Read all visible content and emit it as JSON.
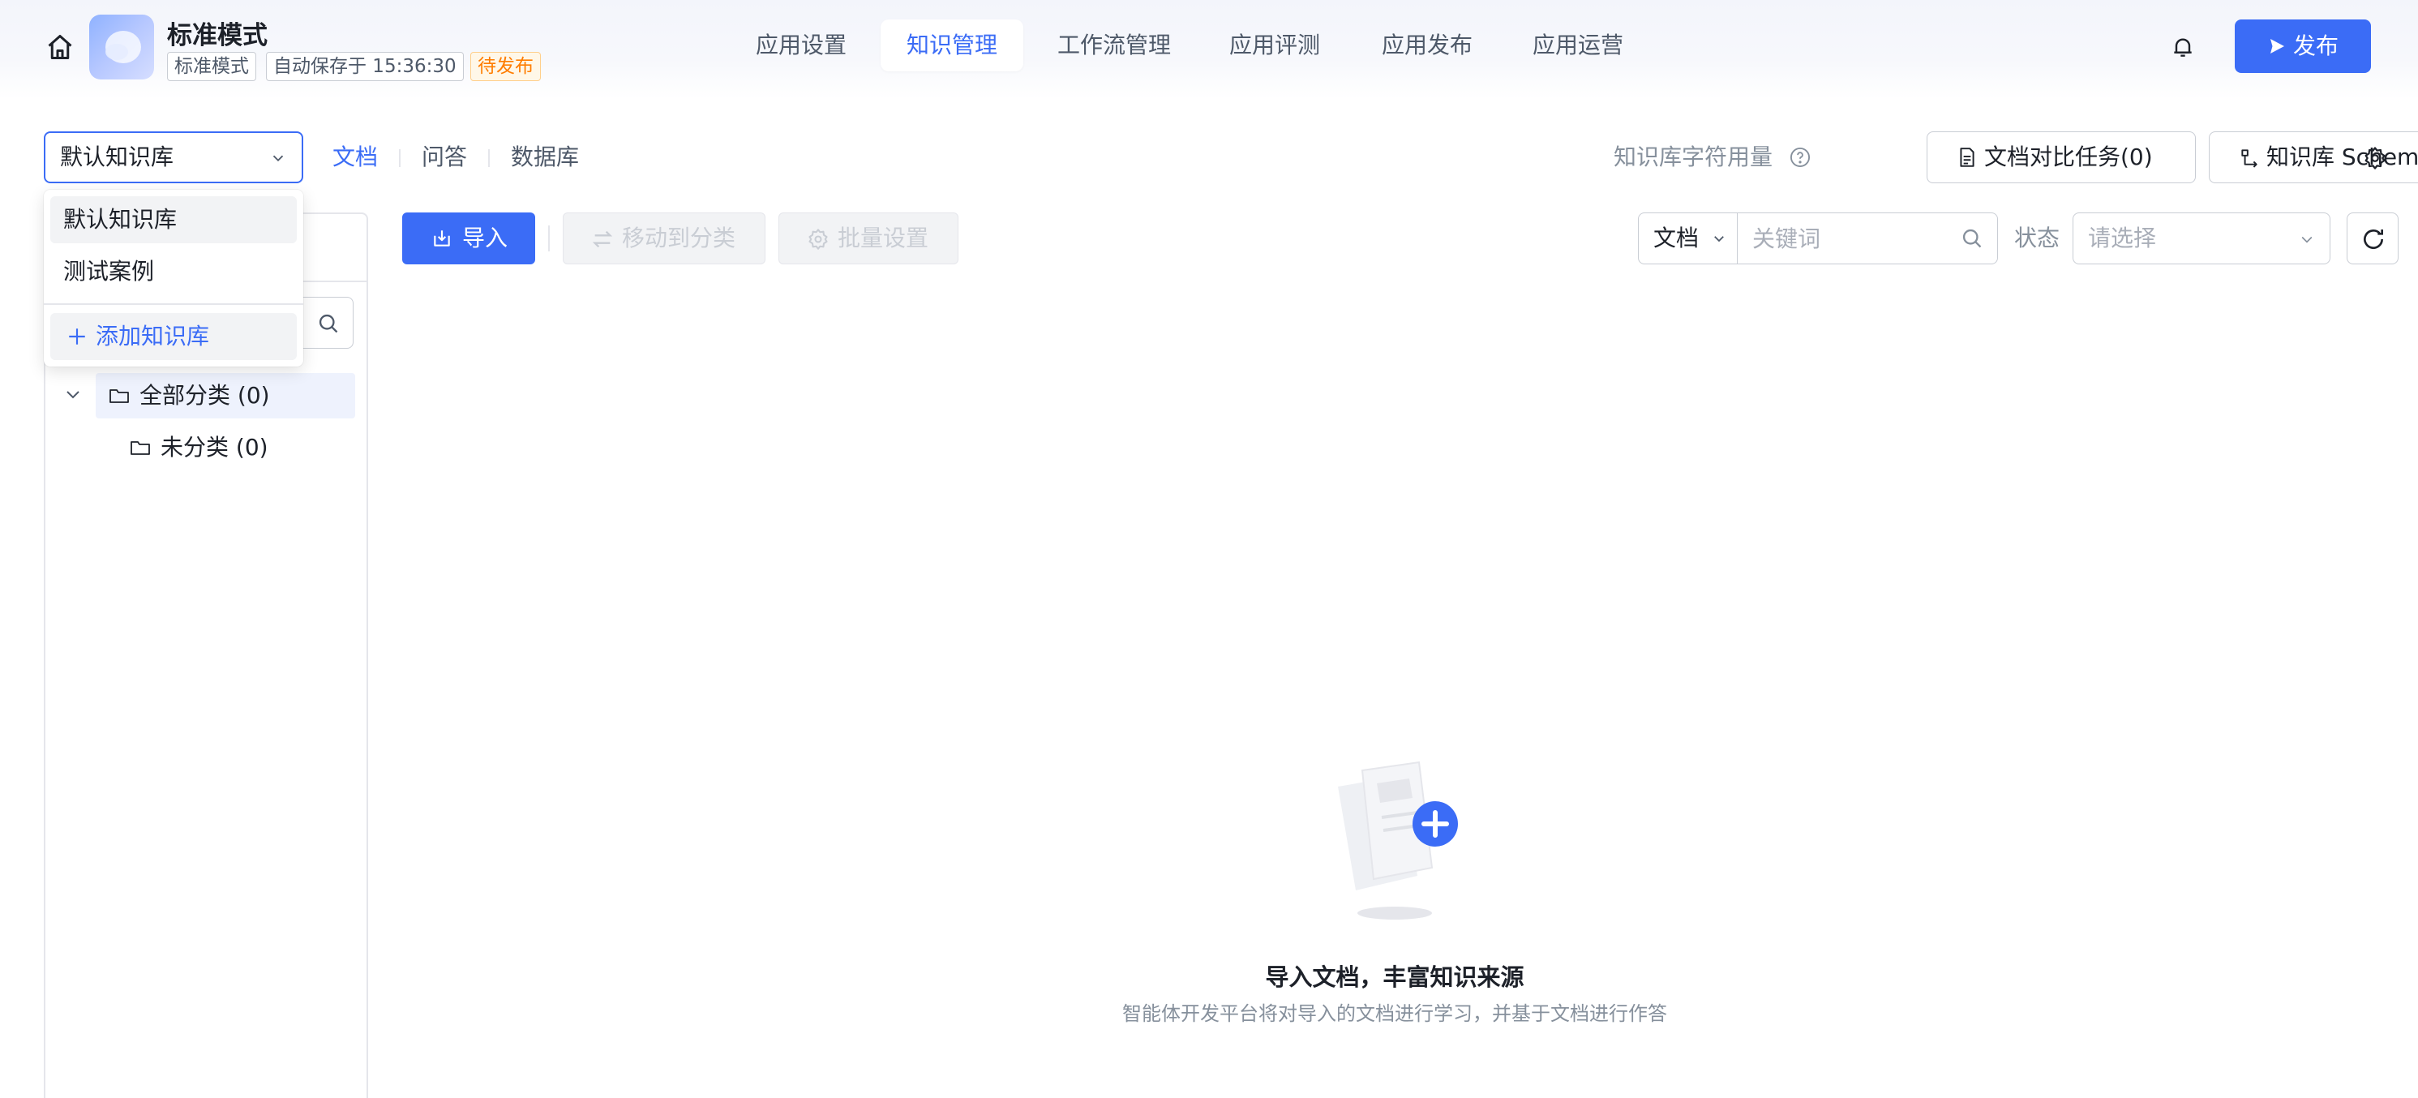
{
  "app": {
    "title": "标准模式",
    "tags": [
      "标准模式",
      "自动保存于 15:36:30",
      "待发布"
    ],
    "publish_label": "发布"
  },
  "nav": {
    "items": [
      "应用设置",
      "知识管理",
      "工作流管理",
      "应用评测",
      "应用发布",
      "应用运营"
    ],
    "active": "知识管理"
  },
  "knowledge": {
    "selected_base": "默认知识库",
    "tabs": [
      "文档",
      "问答",
      "数据库"
    ],
    "active_tab": "文档",
    "usage_label": "知识库字符用量",
    "compare_tasks_label": "文档对比任务(0)",
    "schema_label": "知识库 Schema"
  },
  "dropdown": {
    "items": [
      "默认知识库",
      "测试案例"
    ],
    "add_label": "添加知识库"
  },
  "tree": {
    "all_label": "全部分类 (0)",
    "uncategorized_label": "未分类 (0)"
  },
  "toolbar": {
    "import_label": "导入",
    "move_label": "移动到分类",
    "batch_label": "批量设置",
    "filter_type": "文档",
    "keyword_placeholder": "关键词",
    "status_label": "状态",
    "status_placeholder": "请选择"
  },
  "empty": {
    "title": "导入文档，丰富知识来源",
    "desc": "智能体开发平台将对导入的文档进行学习，并基于文档进行作答"
  },
  "colors": {
    "primary": "#3b6cf6",
    "pending": "#ff7d00",
    "border": "#c9cdd4",
    "muted": "#86909c"
  }
}
